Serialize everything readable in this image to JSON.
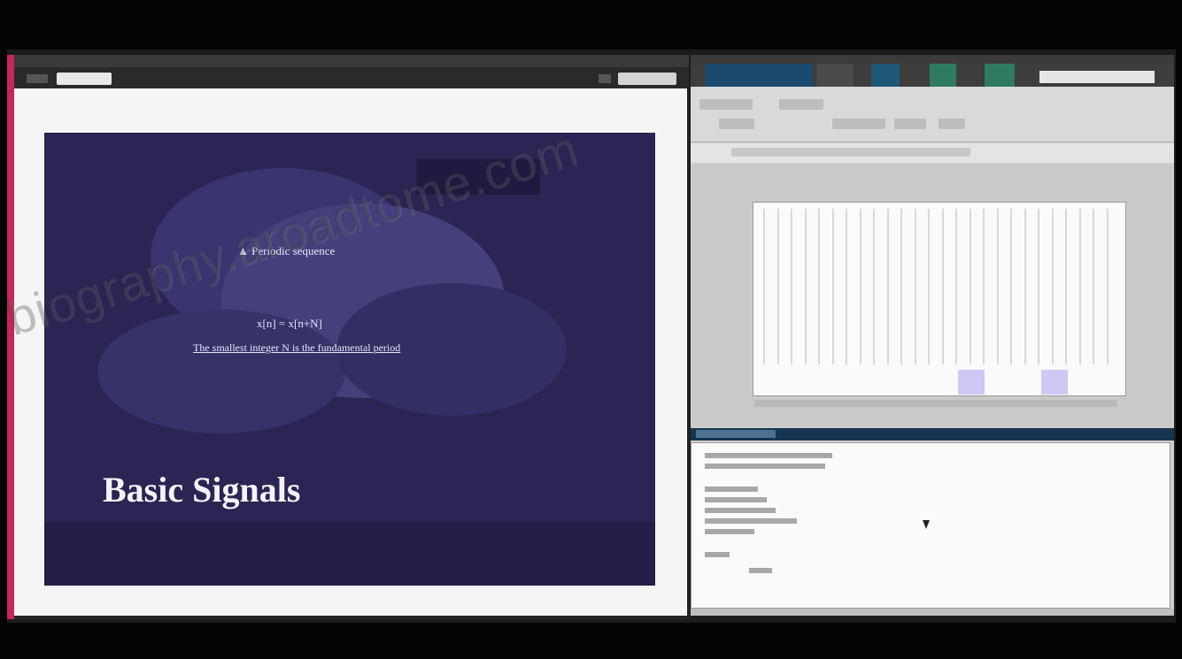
{
  "slide": {
    "heading": "▲ Periodic sequence",
    "formula": "x[n] = x[n+N]",
    "bullet": "The smallest integer N is the fundamental period",
    "title": "Basic Signals"
  },
  "watermark": {
    "text": "biography.aroadtome.com"
  },
  "colors": {
    "slide_background": "#2a2552",
    "left_edge_accent": "#c2285a",
    "right_toolbar_tab": "#1c4a6e",
    "command_header": "#173451",
    "highlight": "#cfc8f5"
  },
  "icons": {
    "cursor": "mouse-pointer-icon"
  }
}
